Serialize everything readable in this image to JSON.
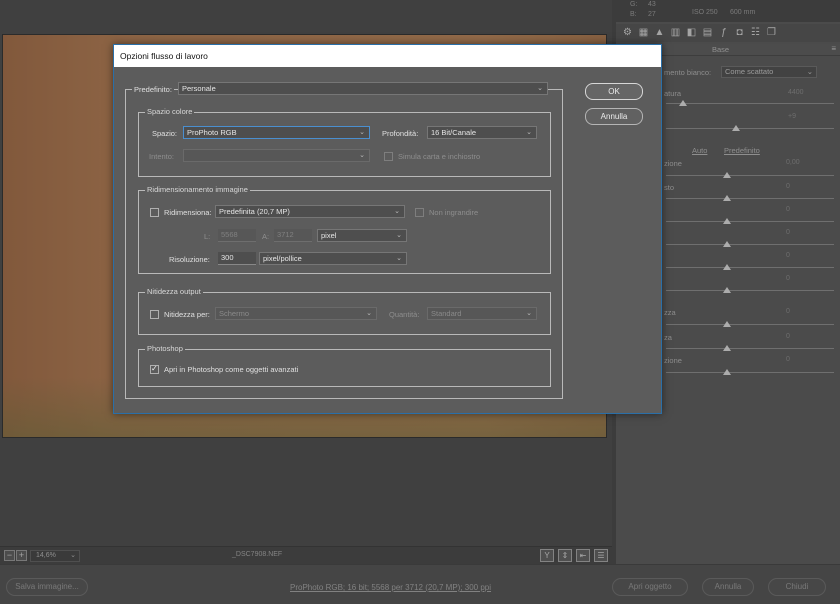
{
  "background": {
    "histogram_info": {
      "g": "G:",
      "g_val": "43",
      "b": "B:",
      "b_val": "27",
      "iso": "ISO 250",
      "focal": "600 mm"
    },
    "panel_title": "Base",
    "white_balance_label": "mento bianco:",
    "white_balance_value": "Come scattato",
    "right_rows": [
      {
        "label": "atura",
        "value": "4400"
      },
      {
        "label": "",
        "value": "+9"
      },
      {
        "label": "Auto",
        "value": "Predefinito"
      },
      {
        "label": "zione",
        "value": "0,00"
      },
      {
        "label": "sto",
        "value": "0"
      },
      {
        "label": "",
        "value": "0"
      },
      {
        "label": "",
        "value": "0"
      },
      {
        "label": "",
        "value": "0"
      },
      {
        "label": "",
        "value": "0"
      },
      {
        "label": "zza",
        "value": "0"
      },
      {
        "label": "za",
        "value": "0"
      },
      {
        "label": "zione",
        "value": "0"
      }
    ],
    "zoom": "14,6%",
    "filename": "_DSC7908.NEF",
    "save_button": "Salva immagine...",
    "workflow_link": "ProPhoto RGB; 16 bit; 5568 per 3712 (20,7 MP); 300 ppi",
    "open_button": "Apri oggetto",
    "cancel_button": "Annulla",
    "done_button": "Chiudi"
  },
  "dialog": {
    "title": "Opzioni flusso di lavoro",
    "preset_label": "Predefinito:",
    "preset_value": "Personale",
    "ok": "OK",
    "cancel": "Annulla",
    "color_space": {
      "legend": "Spazio colore",
      "space_label": "Spazio:",
      "space_value": "ProPhoto RGB",
      "depth_label": "Profondità:",
      "depth_value": "16 Bit/Canale",
      "intent_label": "Intento:",
      "intent_value": "",
      "simulate_label": "Simula carta e inchiostro"
    },
    "resize": {
      "legend": "Ridimensionamento immagine",
      "resize_label": "Ridimensiona:",
      "resize_value": "Predefinita (20,7 MP)",
      "no_enlarge_label": "Non ingrandire",
      "l_label": "L:",
      "l_value": "5568",
      "a_label": "A:",
      "a_value": "3712",
      "unit_value": "pixel",
      "resolution_label": "Risoluzione:",
      "resolution_value": "300",
      "resolution_unit": "pixel/pollice"
    },
    "sharpen": {
      "legend": "Nitidezza output",
      "sharpen_label": "Nitidezza per:",
      "sharpen_value": "Schermo",
      "amount_label": "Quantità:",
      "amount_value": "Standard"
    },
    "photoshop": {
      "legend": "Photoshop",
      "smart_objects_label": "Apri in Photoshop come oggetti avanzati",
      "smart_objects_checked": true
    }
  }
}
